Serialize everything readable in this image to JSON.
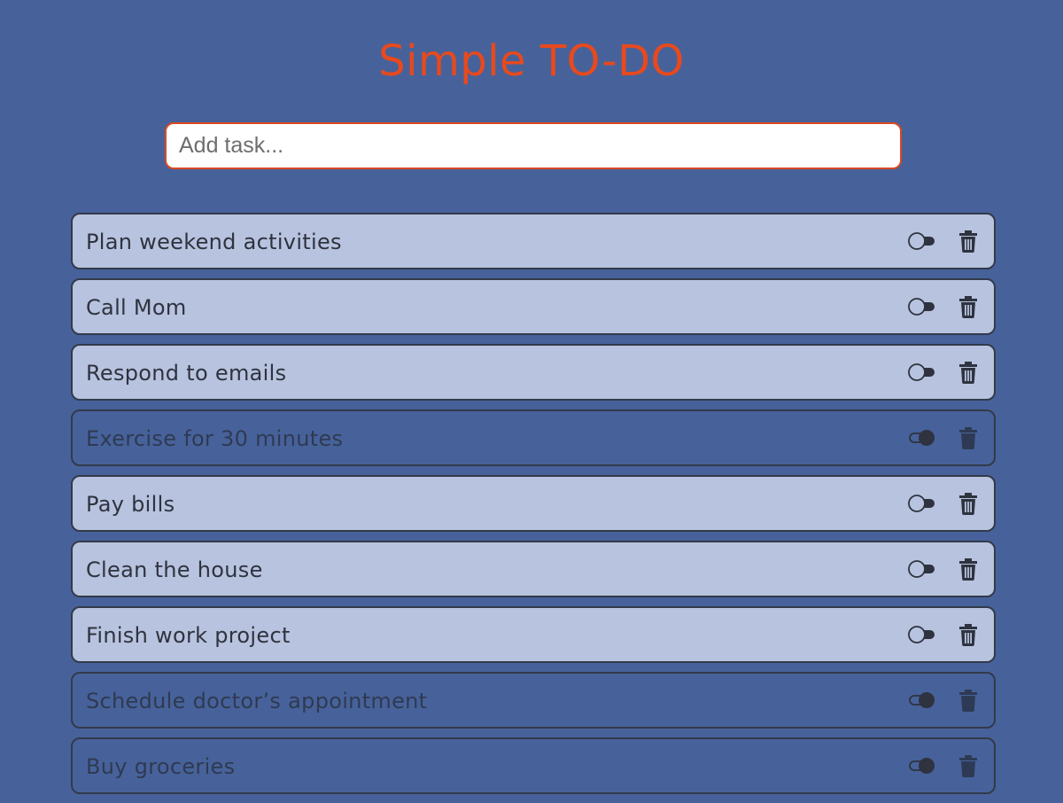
{
  "app": {
    "title": "Simple TO-DO"
  },
  "add_task": {
    "placeholder": "Add task...",
    "value": ""
  },
  "colors": {
    "background": "#47629a",
    "accent": "#e8491d",
    "task_active_bg": "#b8c3df",
    "task_done_bg": "#47629a",
    "text_dark": "#2e333f"
  },
  "icons": {
    "toggle": "toggle-icon",
    "delete": "trash-icon"
  },
  "tasks": [
    {
      "label": "Plan weekend activities",
      "done": false
    },
    {
      "label": "Call Mom",
      "done": false
    },
    {
      "label": "Respond to emails",
      "done": false
    },
    {
      "label": "Exercise for 30 minutes",
      "done": true
    },
    {
      "label": "Pay bills",
      "done": false
    },
    {
      "label": "Clean the house",
      "done": false
    },
    {
      "label": "Finish work project",
      "done": false
    },
    {
      "label": "Schedule doctor’s appointment",
      "done": true
    },
    {
      "label": "Buy groceries",
      "done": true
    }
  ]
}
